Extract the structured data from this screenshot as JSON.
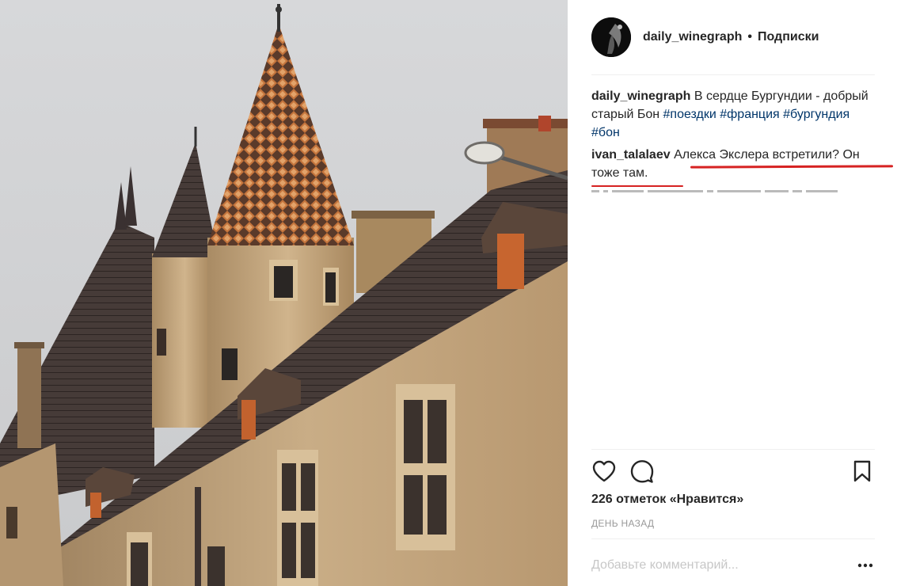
{
  "post": {
    "author": "daily_winegraph",
    "separator": "•",
    "follow_label": "Подписки",
    "caption": {
      "username": "daily_winegraph",
      "text": "В сердце Бургундии - добрый старый Бон",
      "hashtags": [
        "#поездки",
        "#франция",
        "#бургундия",
        "#бон"
      ]
    },
    "comments": [
      {
        "username": "ivan_talalaev",
        "text": "Алекса Экслера встретили? Он тоже там."
      }
    ],
    "likes_label": "226 отметок «Нравится»",
    "time_label": "день назад",
    "comment_placeholder": "Добавьте комментарий...",
    "more_label": "•••"
  },
  "icons": {
    "like": "heart-icon",
    "comment": "speech-bubble-icon",
    "save": "bookmark-icon",
    "more": "more-options-icon"
  },
  "colors": {
    "text": "#262626",
    "hashtag": "#003569",
    "secondary": "#999999",
    "placeholder": "#c7c7c7",
    "annotation": "#d62222"
  }
}
